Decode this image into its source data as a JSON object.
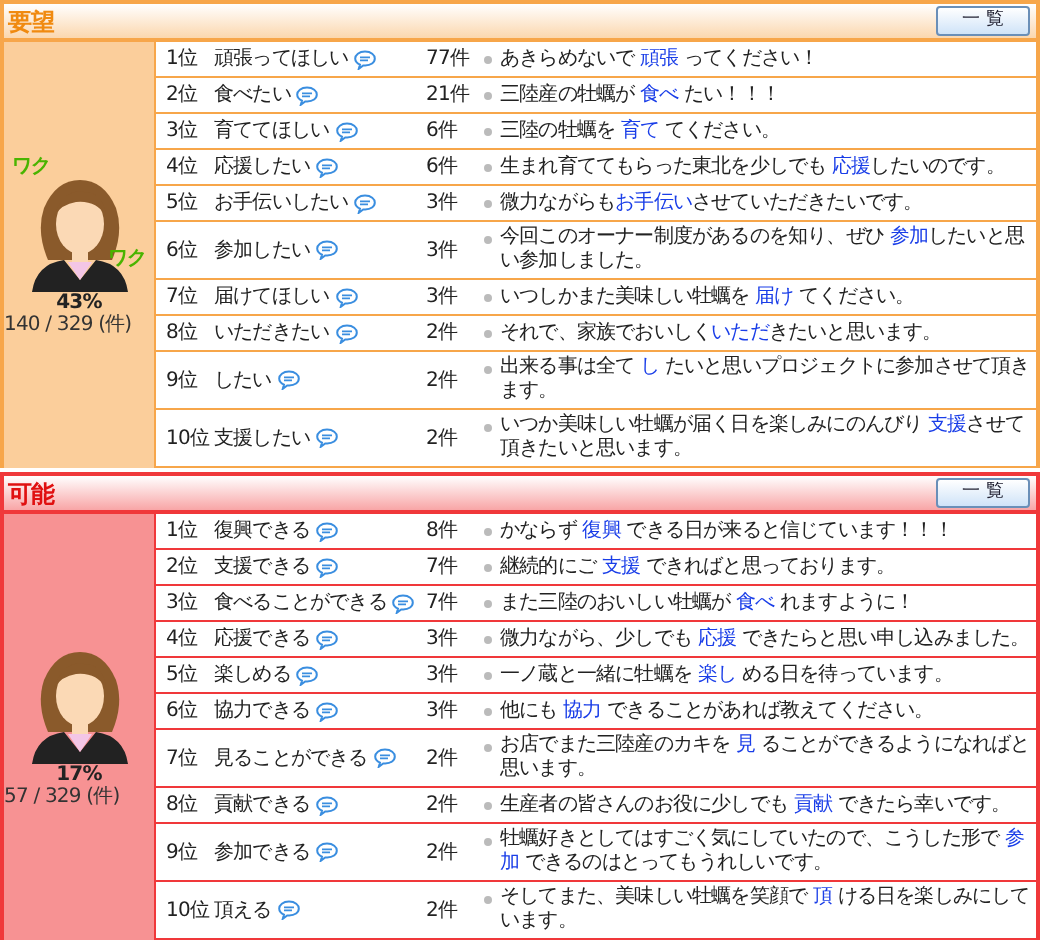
{
  "sections": [
    {
      "title": "要望",
      "color": "#f7a64a",
      "button": "一 覧",
      "percent": "43%",
      "ratio": "140 / 329 (件)",
      "badges": [
        "ワク",
        "ワク"
      ],
      "rows": [
        {
          "rank": "1位",
          "label": "頑張ってほしい",
          "count": "77件",
          "comment": {
            "pre": "あきらめないで ",
            "key": "頑張",
            "post": " ってください！"
          }
        },
        {
          "rank": "2位",
          "label": "食べたい",
          "count": "21件",
          "comment": {
            "pre": "三陸産の牡蠣が ",
            "key": "食べ",
            "post": " たい！！！"
          }
        },
        {
          "rank": "3位",
          "label": "育ててほしい",
          "count": "6件",
          "comment": {
            "pre": "三陸の牡蠣を ",
            "key": "育て",
            "post": " てください。"
          }
        },
        {
          "rank": "4位",
          "label": "応援したい",
          "count": "6件",
          "comment": {
            "pre": "生まれ育ててもらった東北を少しでも ",
            "key": "応援",
            "post": "したいのです。"
          }
        },
        {
          "rank": "5位",
          "label": "お手伝いしたい",
          "count": "3件",
          "comment": {
            "pre": "微力ながらも",
            "key": "お手伝い",
            "post": "させていただきたいです。"
          }
        },
        {
          "rank": "6位",
          "label": "参加したい",
          "count": "3件",
          "comment": {
            "pre": "今回このオーナー制度があるのを知り、ぜひ ",
            "key": "参加",
            "post": "したいと思い参加しました。"
          }
        },
        {
          "rank": "7位",
          "label": "届けてほしい",
          "count": "3件",
          "comment": {
            "pre": "いつしかまた美味しい牡蠣を ",
            "key": "届け",
            "post": " てください。"
          }
        },
        {
          "rank": "8位",
          "label": "いただきたい",
          "count": "2件",
          "comment": {
            "pre": "それで、家族でおいしく",
            "key": "いただ",
            "post": "きたいと思います。"
          }
        },
        {
          "rank": "9位",
          "label": "したい",
          "count": "2件",
          "comment": {
            "pre": "出来る事は全て ",
            "key": "し",
            "post": " たいと思いプロジェクトに参加させて頂きます。"
          }
        },
        {
          "rank": "10位",
          "label": "支援したい",
          "count": "2件",
          "comment": {
            "pre": "いつか美味しい牡蠣が届く日を楽しみにのんびり ",
            "key": "支援",
            "post": "させて頂きたいと思います。"
          }
        }
      ]
    },
    {
      "title": "可能",
      "color": "#f0383a",
      "button": "一 覧",
      "percent": "17%",
      "ratio": "57 / 329 (件)",
      "rows": [
        {
          "rank": "1位",
          "label": "復興できる",
          "count": "8件",
          "comment": {
            "pre": "かならず ",
            "key": "復興",
            "post": " できる日が来ると信じています！！！"
          }
        },
        {
          "rank": "2位",
          "label": "支援できる",
          "count": "7件",
          "comment": {
            "pre": "継続的にご ",
            "key": "支援",
            "post": " できればと思っております。"
          }
        },
        {
          "rank": "3位",
          "label": "食べることができる",
          "count": "7件",
          "comment": {
            "pre": "また三陸のおいしい牡蠣が ",
            "key": "食べ",
            "post": " れますように！"
          }
        },
        {
          "rank": "4位",
          "label": "応援できる",
          "count": "3件",
          "comment": {
            "pre": "微力ながら、少しでも ",
            "key": "応援",
            "post": " できたらと思い申し込みました。"
          }
        },
        {
          "rank": "5位",
          "label": "楽しめる",
          "count": "3件",
          "comment": {
            "pre": "一ノ蔵と一緒に牡蠣を ",
            "key": "楽し",
            "post": " める日を待っています。"
          }
        },
        {
          "rank": "6位",
          "label": "協力できる",
          "count": "3件",
          "comment": {
            "pre": "他にも ",
            "key": "協力",
            "post": " できることがあれば教えてください。"
          }
        },
        {
          "rank": "7位",
          "label": "見ることができる",
          "count": "2件",
          "comment": {
            "pre": "お店でまた三陸産のカキを ",
            "key": "見",
            "post": " ることができるようになればと思います。"
          }
        },
        {
          "rank": "8位",
          "label": "貢献できる",
          "count": "2件",
          "comment": {
            "pre": "生産者の皆さんのお役に少しでも ",
            "key": "貢献",
            "post": " できたら幸いです。"
          }
        },
        {
          "rank": "9位",
          "label": "参加できる",
          "count": "2件",
          "comment": {
            "pre": "牡蠣好きとしてはすごく気にしていたので、こうした形で ",
            "key": "参加",
            "post": " できるのはとってもうれしいです。"
          }
        },
        {
          "rank": "10位",
          "label": "頂える",
          "count": "2件",
          "comment": {
            "pre": "そしてまた、美味しい牡蠣を笑顔で ",
            "key": "頂",
            "post": " ける日を楽しみにしています。"
          }
        }
      ]
    }
  ]
}
